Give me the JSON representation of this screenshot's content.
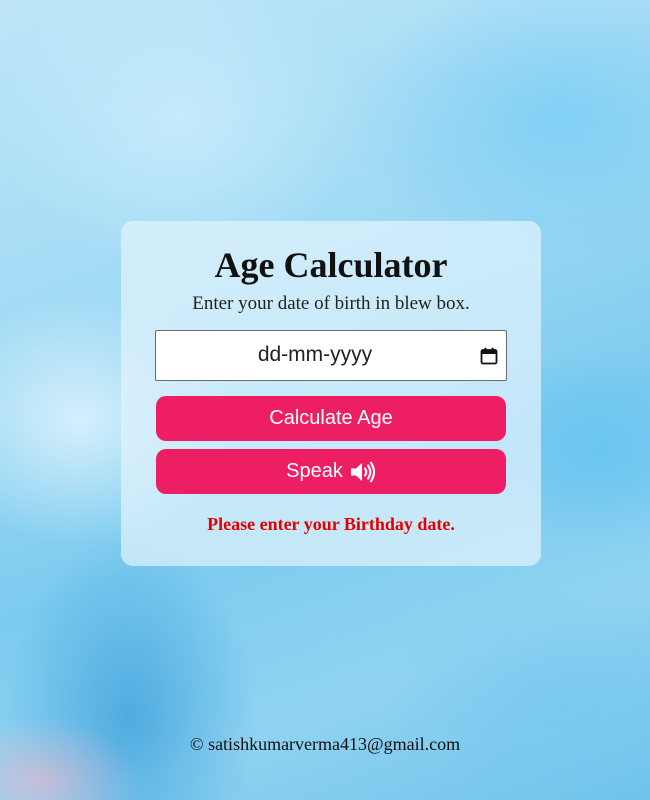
{
  "card": {
    "title": "Age Calculator",
    "subtitle": "Enter your date of birth in blew box.",
    "date_input": {
      "placeholder": "dd-mm-yyyy",
      "value": "",
      "icon": "calendar-icon"
    },
    "calculate_label": "Calculate Age",
    "speak_label": "Speak",
    "speak_icon": "speaker-icon",
    "message": "Please enter your Birthday date."
  },
  "footer": {
    "text": "© satishkumarverma413@gmail.com"
  },
  "colors": {
    "button": "#ed1e63",
    "message": "#e30000",
    "background": "#8fd0f0"
  }
}
